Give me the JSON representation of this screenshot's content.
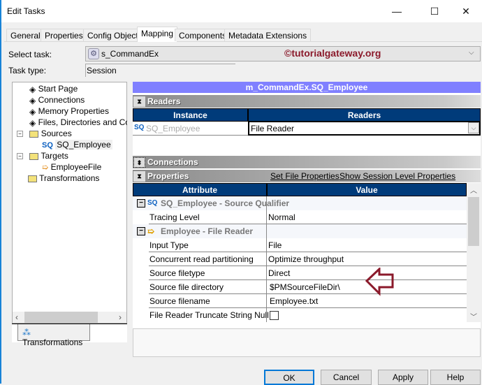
{
  "window": {
    "title": "Edit Tasks",
    "minimize": "—",
    "maximize": "☐",
    "close": "✕"
  },
  "tabs": [
    "General",
    "Properties",
    "Config Object",
    "Mapping",
    "Components",
    "Metadata Extensions"
  ],
  "active_tab": "Mapping",
  "select_task": {
    "label": "Select task:",
    "value": "s_CommandEx",
    "watermark": "©tutorialgateway.org"
  },
  "task_type": {
    "label": "Task type:",
    "value": "Session"
  },
  "tree": {
    "items": [
      {
        "label": "Start Page",
        "icon": "diamond-icon"
      },
      {
        "label": "Connections",
        "icon": "diamond-icon"
      },
      {
        "label": "Memory Properties",
        "icon": "diamond-icon"
      },
      {
        "label": "Files, Directories and Commands",
        "icon": "diamond-icon"
      },
      {
        "label": "Sources",
        "icon": "folder-icon"
      },
      {
        "label": "SQ_Employee",
        "icon": "source-qualifier-icon",
        "selected": true
      },
      {
        "label": "Targets",
        "icon": "folder-icon"
      },
      {
        "label": "EmployeeFile",
        "icon": "target-file-icon"
      },
      {
        "label": "Transformations",
        "icon": "folder-icon"
      }
    ],
    "bottom_tab": "Transformations"
  },
  "mapping_title": "m_CommandEx.SQ_Employee",
  "readers": {
    "section": "Readers",
    "headers": [
      "Instance",
      "Readers"
    ],
    "instance": "SQ_Employee",
    "sq": "SQ",
    "reader": "File Reader"
  },
  "connections": {
    "section": "Connections"
  },
  "properties": {
    "section": "Properties",
    "links": [
      "Set File Properties",
      "Show Session Level Properties"
    ],
    "headers": [
      "Attribute",
      "Value"
    ],
    "group1": "SQ_Employee - Source Qualifier",
    "group1_rows": [
      {
        "attr": "Tracing Level",
        "value": "Normal"
      }
    ],
    "group2": "Employee - File Reader",
    "group2_rows": [
      {
        "attr": "Input Type",
        "value": "File"
      },
      {
        "attr": "Concurrent read partitioning",
        "value": "Optimize throughput"
      },
      {
        "attr": "Source filetype",
        "value": "Direct"
      },
      {
        "attr": "Source file directory",
        "value": "$PMSourceFileDir\\"
      },
      {
        "attr": "Source filename",
        "value": "Employee.txt"
      },
      {
        "attr": "File Reader Truncate String Null",
        "value": ""
      }
    ]
  },
  "annotation_color": "#8b1a2b",
  "buttons": {
    "ok": "OK",
    "cancel": "Cancel",
    "apply": "Apply",
    "help": "Help"
  }
}
